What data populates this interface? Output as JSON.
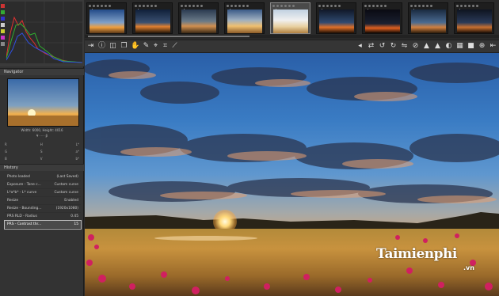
{
  "left_panel": {
    "navigator_title": "Navigator",
    "navigator_info": "Width: 6000, Height: 4016",
    "navigator_sub": "¥ · - · β",
    "lab_rows": [
      {
        "a": "R",
        "b": "H",
        "c": "L*"
      },
      {
        "a": "G",
        "b": "S",
        "c": "a*"
      },
      {
        "a": "B",
        "b": "V",
        "c": "b*"
      }
    ],
    "history_title": "History",
    "history": [
      {
        "name": "Photo loaded",
        "value": "(Last Saved)"
      },
      {
        "name": "Exposure - Tone c...",
        "value": "Custom curve"
      },
      {
        "name": "L*a*b* - L* curve",
        "value": "Custom curve"
      },
      {
        "name": "Resize",
        "value": "Enabled"
      },
      {
        "name": "Resize - Bounding...",
        "value": "(1920x1080)"
      },
      {
        "name": "PRS RLD - Radius",
        "value": "0.45"
      },
      {
        "name": "PRS - Contrast thr...",
        "value": "15"
      }
    ]
  },
  "filmstrip": {
    "thumb_count": 9
  },
  "toolbar": {
    "icons": [
      "expand-icon",
      "info-icon",
      "before-after-icon",
      "copy-icon",
      "hand-icon",
      "picker-icon",
      "wb-picker-icon",
      "crop-icon",
      "rotate-icon",
      "straighten-icon"
    ],
    "right_icons": [
      "prev-icon",
      "sync-icon",
      "rotate-ccw-icon",
      "rotate-cw-icon",
      "flip-icon",
      "ban-icon",
      "grid-icon",
      "color-icon",
      "zoom-icon",
      "next-icon"
    ]
  },
  "watermark": {
    "main": "Taimienphi",
    "sub": ".vn"
  },
  "colors": {
    "accent": "#e0a060",
    "panel": "#333333"
  }
}
